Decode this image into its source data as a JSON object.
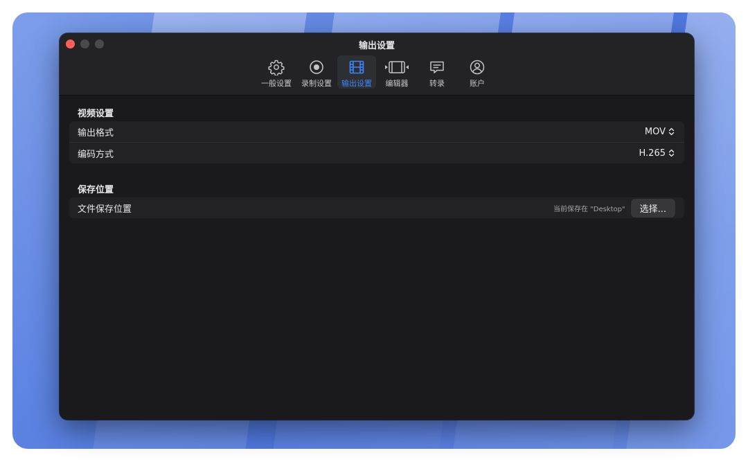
{
  "window": {
    "title": "输出设置"
  },
  "tabs": [
    {
      "id": "general",
      "label": "一般设置",
      "icon": "gear-icon",
      "active": false
    },
    {
      "id": "record",
      "label": "录制设置",
      "icon": "record-icon",
      "active": false
    },
    {
      "id": "output",
      "label": "输出设置",
      "icon": "film-icon",
      "active": true
    },
    {
      "id": "editor",
      "label": "编辑器",
      "icon": "trim-icon",
      "active": false
    },
    {
      "id": "transcribe",
      "label": "转录",
      "icon": "caption-bubble-icon",
      "active": false
    },
    {
      "id": "account",
      "label": "账户",
      "icon": "account-icon",
      "active": false
    }
  ],
  "video": {
    "title": "视频设置",
    "format": {
      "label": "输出格式",
      "value": "MOV"
    },
    "codec": {
      "label": "编码方式",
      "value": "H.265"
    }
  },
  "save": {
    "title": "保存位置",
    "location": {
      "label": "文件保存位置",
      "hint": "当前保存在 \"Desktop\"",
      "button": "选择..."
    }
  },
  "colors": {
    "accent": "#3a86ff",
    "window_bg": "#1a1a1c",
    "toolbar_bg": "#232326",
    "close": "#ff5f57"
  }
}
